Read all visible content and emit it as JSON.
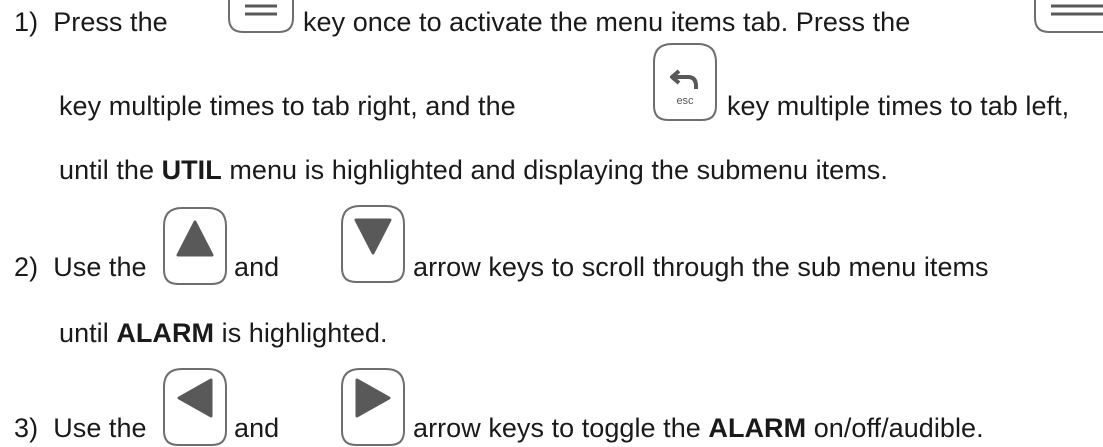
{
  "steps": [
    {
      "number": "1)",
      "line1": {
        "a": "Press the",
        "b": "key once to activate the menu items tab.  Press the"
      },
      "line2": {
        "a": "key multiple times to tab right, and the",
        "b": "key multiple times to tab left,"
      },
      "line3": {
        "a": "until the",
        "bold": "UTIL",
        "b": "menu is highlighted and displaying the submenu items."
      }
    },
    {
      "number": "2)",
      "line1": {
        "a": "Use the",
        "b": "and",
        "c": "arrow keys to scroll through the sub menu items"
      },
      "line2": {
        "a": "until",
        "bold": "ALARM",
        "b": "is highlighted."
      }
    },
    {
      "number": "3)",
      "line1": {
        "a": "Use the",
        "b": "and",
        "c": "arrow keys to toggle the",
        "bold": "ALARM",
        "d": "on/off/audible."
      }
    }
  ],
  "keys": {
    "menu_icon": "menu-key-icon",
    "esc_icon": "esc-key-icon",
    "esc_label": "esc",
    "up_icon": "up-arrow-key-icon",
    "down_icon": "down-arrow-key-icon",
    "left_icon": "left-arrow-key-icon",
    "right_icon": "right-arrow-key-icon"
  },
  "colors": {
    "text": "#1a1a1a",
    "key_outline": "#6e6e6e",
    "glyph": "#595959"
  }
}
